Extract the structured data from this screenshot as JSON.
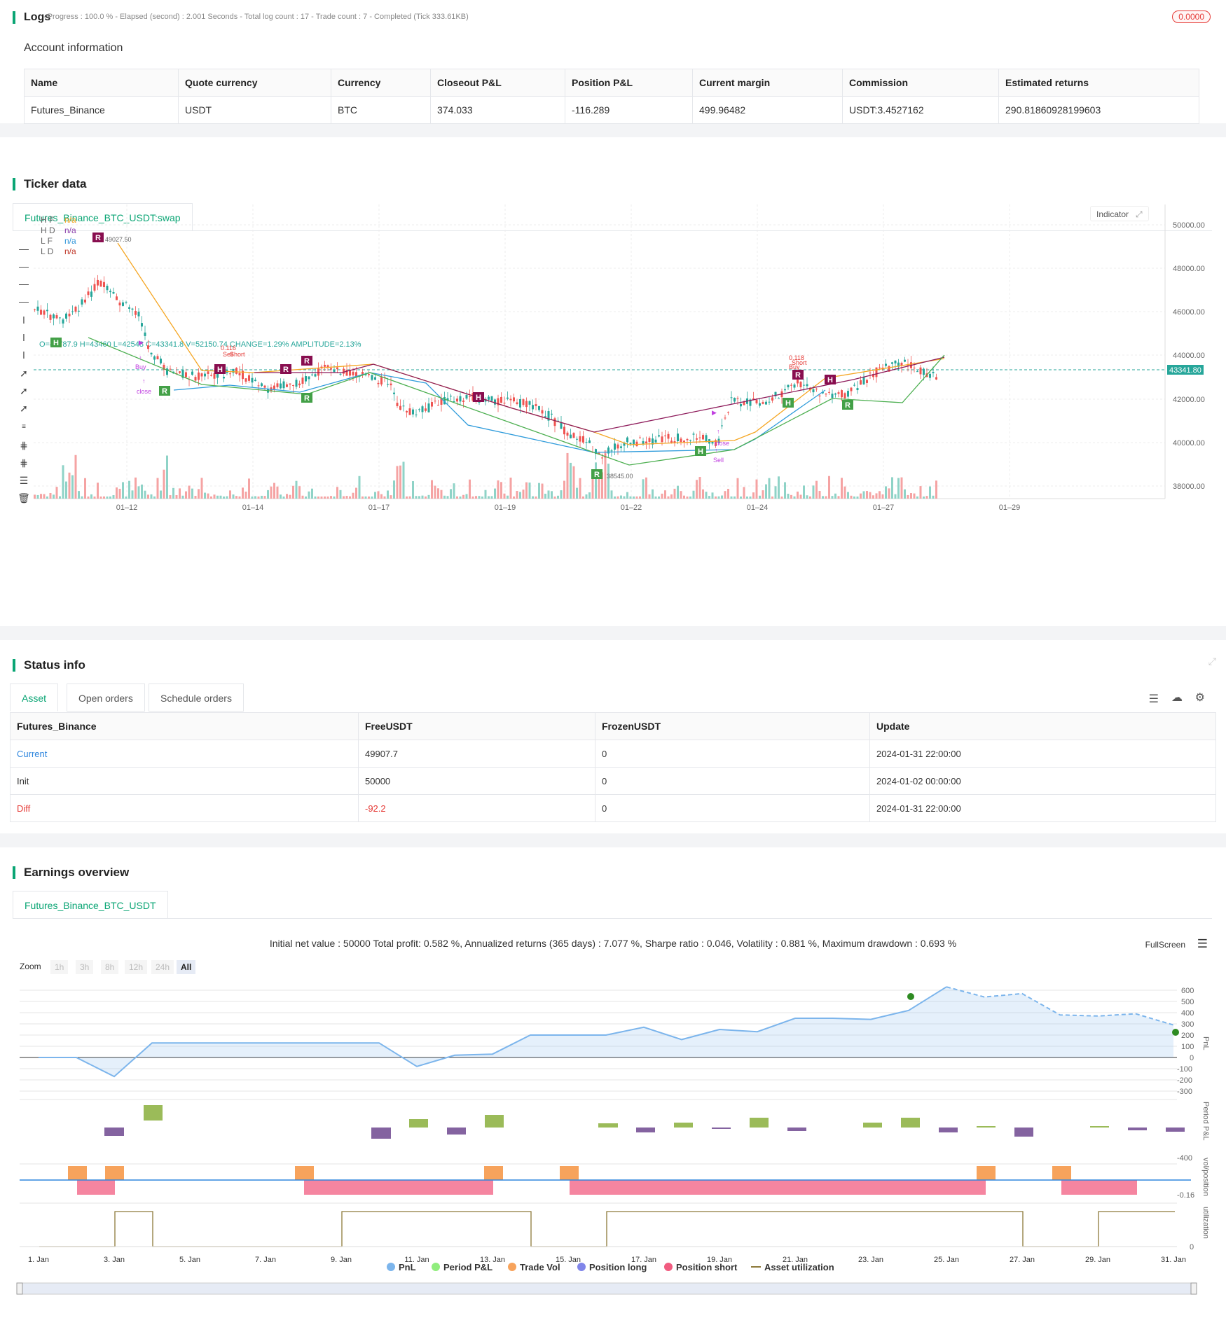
{
  "logs": {
    "title": "Logs",
    "progress": "- Progress : 100.0 % - Elapsed (second) : 2.001 Seconds - Total log count : 17 - Trade count : 7 - Completed (Tick 333.61KB)",
    "badge": "0.0000",
    "account_title": "Account information",
    "columns": [
      "Name",
      "Quote currency",
      "Currency",
      "Closeout P&L",
      "Position P&L",
      "Current margin",
      "Commission",
      "Estimated returns"
    ],
    "row": [
      "Futures_Binance",
      "USDT",
      "BTC",
      "374.033",
      "-116.289",
      "499.96482",
      "USDT:3.4527162",
      "290.81860928199603"
    ]
  },
  "ticker": {
    "title": "Ticker data",
    "tab": "Futures_Binance_BTC_USDT:swap",
    "ohlc": "O=42787.9 H=43460 L=42548 C=43341.8 V=52150.74 CHANGE=1.29% AMPLITUDE=2.13%",
    "legend": [
      {
        "name": "H F",
        "value": "n/a",
        "color": "#f5a623"
      },
      {
        "name": "H D",
        "value": "n/a",
        "color": "#8e44ad"
      },
      {
        "name": "L F",
        "value": "n/a",
        "color": "#3498db"
      },
      {
        "name": "L D",
        "value": "n/a",
        "color": "#c0392b"
      }
    ],
    "indicator_label": "Indicator",
    "price_labels": [
      "50000.00",
      "48000.00",
      "46000.00",
      "44000.00",
      "42000.00",
      "40000.00",
      "38000.00"
    ],
    "current_price": "43341.80",
    "date_labels": [
      "01–12",
      "01–14",
      "01–17",
      "01–19",
      "01–22",
      "01–24",
      "01–27",
      "01–29"
    ],
    "high_label": "49027.50",
    "low_label": "38545.00",
    "annotations": {
      "a1": "0.116",
      "a2": "Sell",
      "a3": "Short",
      "a4": "Buy",
      "a5": "close",
      "a6": "0.118",
      "a7": "Short",
      "a8": "Buy",
      "a9": "close",
      "a10": "Sell"
    }
  },
  "status": {
    "title": "Status info",
    "tabs": [
      "Asset",
      "Open orders",
      "Schedule orders"
    ],
    "columns": [
      "Futures_Binance",
      "FreeUSDT",
      "FrozenUSDT",
      "Update"
    ],
    "rows": [
      [
        "Current",
        "49907.7",
        "0",
        "2024-01-31 22:00:00"
      ],
      [
        "Init",
        "50000",
        "0",
        "2024-01-02 00:00:00"
      ],
      [
        "Diff",
        "-92.2",
        "0",
        "2024-01-31 22:00:00"
      ]
    ]
  },
  "earnings": {
    "title": "Earnings overview",
    "tab": "Futures_Binance_BTC_USDT",
    "summary": "Initial net value : 50000 Total profit: 0.582 %, Annualized returns (365 days) : 7.077 %, Sharpe ratio : 0.046, Volatility : 0.881 %, Maximum drawdown : 0.693 %",
    "fullscreen": "FullScreen",
    "zoom_label": "Zoom",
    "zoom_buttons": [
      "1h",
      "3h",
      "8h",
      "12h",
      "24h",
      "All"
    ],
    "pnl_axis": [
      "600",
      "500",
      "400",
      "300",
      "200",
      "100",
      "0",
      "-100",
      "-200",
      "-300"
    ],
    "period_axis": "-400",
    "vol_axis": "-0.16",
    "util_axis": "0",
    "axis_titles": [
      "PnL",
      "Period P&L",
      "vol/position",
      "utilization"
    ],
    "x_labels": [
      "1. Jan",
      "3. Jan",
      "5. Jan",
      "7. Jan",
      "9. Jan",
      "11. Jan",
      "13. Jan",
      "15. Jan",
      "17. Jan",
      "19. Jan",
      "21. Jan",
      "23. Jan",
      "25. Jan",
      "27. Jan",
      "29. Jan",
      "31. Jan"
    ],
    "legend": [
      {
        "name": "PnL",
        "color": "#7cb5ec"
      },
      {
        "name": "Period P&L",
        "color": "#90ed7d"
      },
      {
        "name": "Trade Vol",
        "color": "#f7a35c"
      },
      {
        "name": "Position long",
        "color": "#8085e9"
      },
      {
        "name": "Position short",
        "color": "#f15c80"
      },
      {
        "name": "Asset utilization",
        "color": "#8d7a3a"
      }
    ]
  },
  "chart_data": {
    "type": "line",
    "title": "",
    "xlabel": "",
    "ylabel": "PnL",
    "x": [
      "1. Jan",
      "2. Jan",
      "3. Jan",
      "4. Jan",
      "5. Jan",
      "6. Jan",
      "7. Jan",
      "8. Jan",
      "9. Jan",
      "10. Jan",
      "11. Jan",
      "12. Jan",
      "13. Jan",
      "14. Jan",
      "15. Jan",
      "16. Jan",
      "17. Jan",
      "18. Jan",
      "19. Jan",
      "20. Jan",
      "21. Jan",
      "22. Jan",
      "23. Jan",
      "24. Jan",
      "25. Jan",
      "26. Jan",
      "27. Jan",
      "28. Jan",
      "29. Jan",
      "30. Jan",
      "31. Jan"
    ],
    "series": [
      {
        "name": "PnL",
        "values": [
          0,
          0,
          -170,
          130,
          130,
          130,
          130,
          130,
          130,
          130,
          -80,
          20,
          30,
          200,
          200,
          200,
          270,
          160,
          250,
          230,
          350,
          350,
          340,
          420,
          630,
          540,
          570,
          380,
          370,
          390,
          290
        ]
      }
    ],
    "ylim": [
      -300,
      600
    ]
  }
}
